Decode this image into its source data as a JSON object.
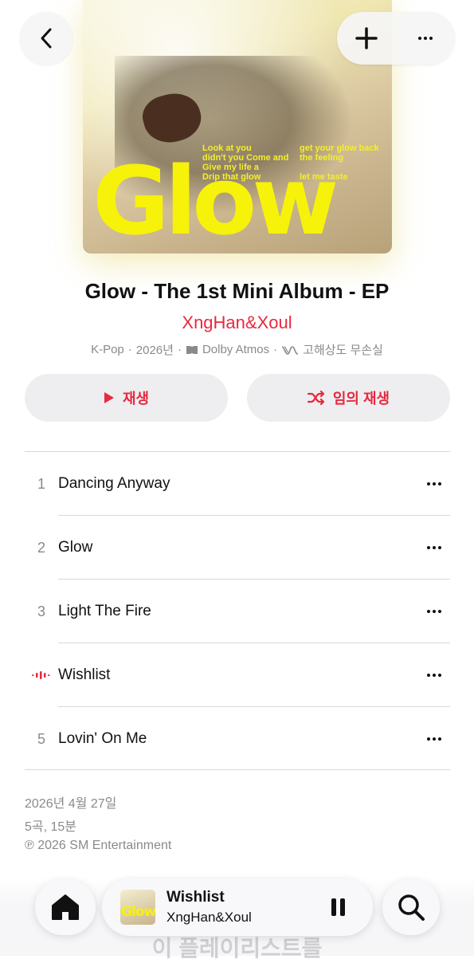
{
  "album": {
    "title": "Glow - The 1st Mini Album - EP",
    "artist": "XngHan&Xoul",
    "genre": "K-Pop",
    "year": "2026년",
    "dolby": "Dolby Atmos",
    "lossless": "고해상도 무손실",
    "cover_word": "Glow",
    "cover_lyrics_left": [
      "Look at you",
      "didn't you Come and",
      "Give my life a",
      "Drip that glow"
    ],
    "cover_lyrics_right": [
      "get your glow back",
      "the feeling",
      "",
      "let me taste"
    ]
  },
  "actions": {
    "play_label": "재생",
    "shuffle_label": "임의 재생"
  },
  "tracks": [
    {
      "num": "1",
      "name": "Dancing Anyway",
      "playing": false
    },
    {
      "num": "2",
      "name": "Glow",
      "playing": false
    },
    {
      "num": "3",
      "name": "Light The Fire",
      "playing": false
    },
    {
      "num": "",
      "name": "Wishlist",
      "playing": true
    },
    {
      "num": "5",
      "name": "Lovin' On Me",
      "playing": false
    }
  ],
  "footer": {
    "release_date": "2026년 4월 27일",
    "summary": "5곡, 15분",
    "copyright": "℗ 2026 SM Entertainment"
  },
  "now_playing": {
    "title": "Wishlist",
    "artist": "XngHan&Xoul",
    "thumb_word": "Glow"
  },
  "bottom_ghost_text": "이 플레이리스트를",
  "colors": {
    "accent": "#e8293f",
    "secondary_text": "#8a8a8e"
  }
}
